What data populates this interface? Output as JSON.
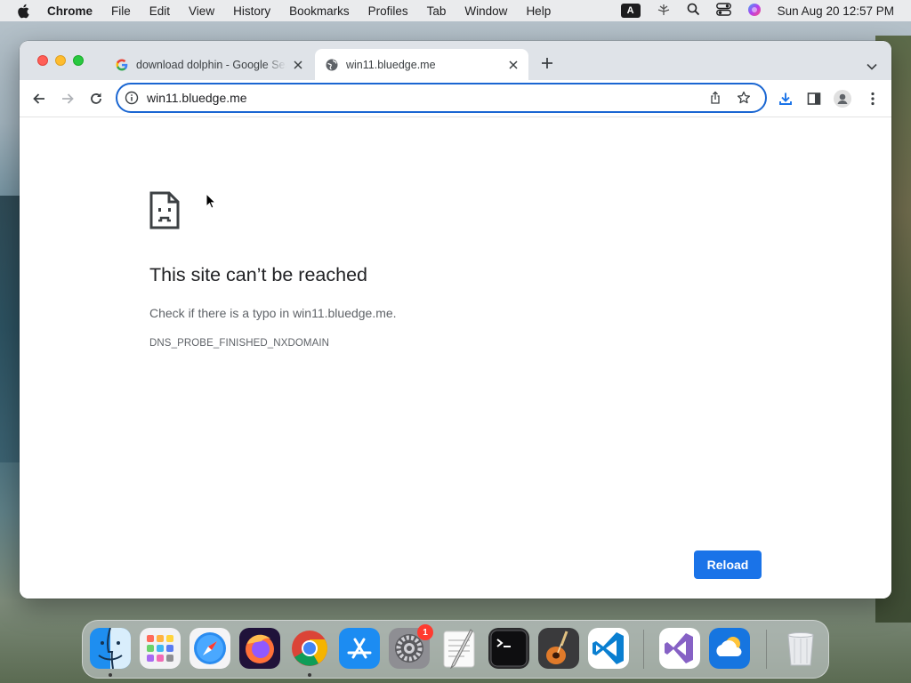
{
  "menubar": {
    "app_name": "Chrome",
    "items": [
      "File",
      "Edit",
      "View",
      "History",
      "Bookmarks",
      "Profiles",
      "Tab",
      "Window",
      "Help"
    ],
    "input_source": "A",
    "clock": "Sun Aug 20  12:57 PM"
  },
  "tabs": [
    {
      "title": "download dolphin - Google Search",
      "favicon": "google-g-icon",
      "active": false
    },
    {
      "title": "win11.bluedge.me",
      "favicon": "globe-icon",
      "active": true
    }
  ],
  "omnibox": {
    "url": "win11.bluedge.me"
  },
  "error_page": {
    "title": "This site can’t be reached",
    "description": "Check if there is a typo in win11.bluedge.me.",
    "error_code": "DNS_PROBE_FINISHED_NXDOMAIN",
    "reload_label": "Reload"
  },
  "dock": {
    "apps": [
      "Finder",
      "Launchpad",
      "Safari",
      "Firefox",
      "Google Chrome",
      "App Store",
      "System Settings",
      "TextEdit",
      "Terminal",
      "GarageBand",
      "Visual Studio Code",
      "Visual Studio",
      "CloudMounter",
      "Trash"
    ],
    "settings_badge": "1"
  },
  "colors": {
    "accent": "#1a73e8",
    "omnibox_focus": "#1a66d2",
    "tabstrip": "#dfe3e8"
  }
}
